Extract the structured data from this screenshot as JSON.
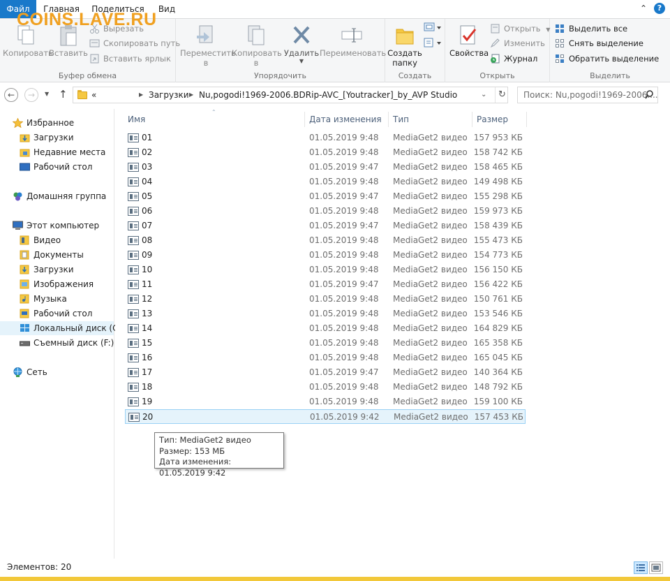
{
  "watermark": "COINS.LAVE.RU",
  "tabs": {
    "file": "Файл",
    "home": "Главная",
    "share": "Поделиться",
    "view": "Вид"
  },
  "ribbon": {
    "clipboard": {
      "title": "Буфер обмена",
      "copy": "Копировать",
      "paste": "Вставить",
      "cut": "Вырезать",
      "copy_path": "Скопировать путь",
      "paste_shortcut": "Вставить ярлык"
    },
    "organize": {
      "title": "Упорядочить",
      "move_to_1": "Переместить",
      "move_to_2": "в",
      "copy_to_1": "Копировать",
      "copy_to_2": "в",
      "delete": "Удалить",
      "rename": "Переименовать"
    },
    "new": {
      "title": "Создать",
      "new_folder_1": "Создать",
      "new_folder_2": "папку"
    },
    "open": {
      "title": "Открыть",
      "properties": "Свойства",
      "open": "Открыть",
      "edit": "Изменить",
      "history": "Журнал"
    },
    "select": {
      "title": "Выделить",
      "select_all": "Выделить все",
      "select_none": "Снять выделение",
      "invert": "Обратить выделение"
    }
  },
  "address": {
    "overflow": "«",
    "segment1": "Загрузки",
    "segment2": "Nu,pogodi!1969-2006.BDRip-AVC_[Youtracker]_by_AVP Studio",
    "search_placeholder": "Поиск: Nu,pogodi!1969-2006...."
  },
  "nav": {
    "favorites": "Избранное",
    "fav_items": [
      "Загрузки",
      "Недавние места",
      "Рабочий стол"
    ],
    "homegroup": "Домашняя группа",
    "this_pc": "Этот компьютер",
    "pc_items": [
      "Видео",
      "Документы",
      "Загрузки",
      "Изображения",
      "Музыка",
      "Рабочий стол",
      "Локальный диск (C:)",
      "Съемный диск (F:)"
    ],
    "network": "Сеть"
  },
  "columns": {
    "name": "Имя",
    "date": "Дата изменения",
    "type": "Тип",
    "size": "Размер"
  },
  "files": [
    {
      "name": "01",
      "date": "01.05.2019 9:48",
      "type": "MediaGet2 видео",
      "size": "157 953 КБ"
    },
    {
      "name": "02",
      "date": "01.05.2019 9:48",
      "type": "MediaGet2 видео",
      "size": "158 742 КБ"
    },
    {
      "name": "03",
      "date": "01.05.2019 9:47",
      "type": "MediaGet2 видео",
      "size": "158 465 КБ"
    },
    {
      "name": "04",
      "date": "01.05.2019 9:48",
      "type": "MediaGet2 видео",
      "size": "149 498 КБ"
    },
    {
      "name": "05",
      "date": "01.05.2019 9:47",
      "type": "MediaGet2 видео",
      "size": "155 298 КБ"
    },
    {
      "name": "06",
      "date": "01.05.2019 9:48",
      "type": "MediaGet2 видео",
      "size": "159 973 КБ"
    },
    {
      "name": "07",
      "date": "01.05.2019 9:47",
      "type": "MediaGet2 видео",
      "size": "158 439 КБ"
    },
    {
      "name": "08",
      "date": "01.05.2019 9:48",
      "type": "MediaGet2 видео",
      "size": "155 473 КБ"
    },
    {
      "name": "09",
      "date": "01.05.2019 9:48",
      "type": "MediaGet2 видео",
      "size": "154 773 КБ"
    },
    {
      "name": "10",
      "date": "01.05.2019 9:48",
      "type": "MediaGet2 видео",
      "size": "156 150 КБ"
    },
    {
      "name": "11",
      "date": "01.05.2019 9:47",
      "type": "MediaGet2 видео",
      "size": "156 422 КБ"
    },
    {
      "name": "12",
      "date": "01.05.2019 9:48",
      "type": "MediaGet2 видео",
      "size": "150 761 КБ"
    },
    {
      "name": "13",
      "date": "01.05.2019 9:48",
      "type": "MediaGet2 видео",
      "size": "153 546 КБ"
    },
    {
      "name": "14",
      "date": "01.05.2019 9:48",
      "type": "MediaGet2 видео",
      "size": "164 829 КБ"
    },
    {
      "name": "15",
      "date": "01.05.2019 9:48",
      "type": "MediaGet2 видео",
      "size": "165 358 КБ"
    },
    {
      "name": "16",
      "date": "01.05.2019 9:48",
      "type": "MediaGet2 видео",
      "size": "165 045 КБ"
    },
    {
      "name": "17",
      "date": "01.05.2019 9:47",
      "type": "MediaGet2 видео",
      "size": "140 364 КБ"
    },
    {
      "name": "18",
      "date": "01.05.2019 9:48",
      "type": "MediaGet2 видео",
      "size": "148 792 КБ"
    },
    {
      "name": "19",
      "date": "01.05.2019 9:48",
      "type": "MediaGet2 видео",
      "size": "159 100 КБ"
    },
    {
      "name": "20",
      "date": "01.05.2019 9:42",
      "type": "MediaGet2 видео",
      "size": "157 453 КБ",
      "selected": true
    }
  ],
  "tooltip": {
    "line1": "Тип: MediaGet2 видео",
    "line2": "Размер: 153 МБ",
    "line3": "Дата изменения: 01.05.2019 9:42"
  },
  "status": {
    "count": "Элементов: 20"
  },
  "colors": {
    "accent": "#1979ca",
    "selection_bg": "#e5f3fb",
    "selection_border": "#99d1f5",
    "header_text": "#4c607a"
  }
}
